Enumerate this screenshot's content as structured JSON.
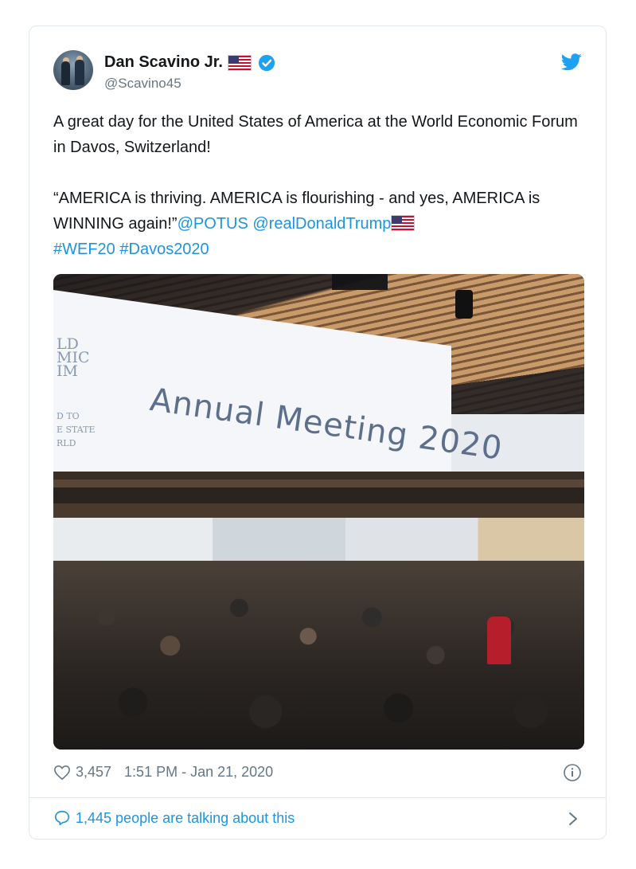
{
  "tweet": {
    "author_name": "Dan Scavino Jr.",
    "author_handle": "@Scavino45",
    "text_line1": "A great day for the United States of America at the World Economic Forum in Davos, Switzerland!",
    "quote": "“AMERICA is thriving. AMERICA is flourishing - and yes, AMERICA is WINNING again!”",
    "mention1": "@POTUS",
    "mention2": "@realDonaldTrump",
    "hashtag1": "#WEF20",
    "hashtag2": "#Davos2020"
  },
  "photo": {
    "banner_text": "Annual Meeting 2020",
    "banner_fragments": "LD\nMIC\nIM",
    "banner_fragments_small": "D TO\nE STATE\nRLD"
  },
  "footer": {
    "like_count": "3,457",
    "timestamp": "1:51 PM - Jan 21, 2020",
    "talking": "1,445 people are talking about this"
  },
  "colors": {
    "link": "#1b95e0",
    "verified": "#1da1f2",
    "text": "#14171a",
    "secondary": "#657786"
  },
  "icons": [
    "verified-badge-icon",
    "twitter-bird-icon",
    "heart-icon",
    "info-icon",
    "speech-bubble-icon",
    "chevron-right-icon",
    "us-flag-icon"
  ]
}
